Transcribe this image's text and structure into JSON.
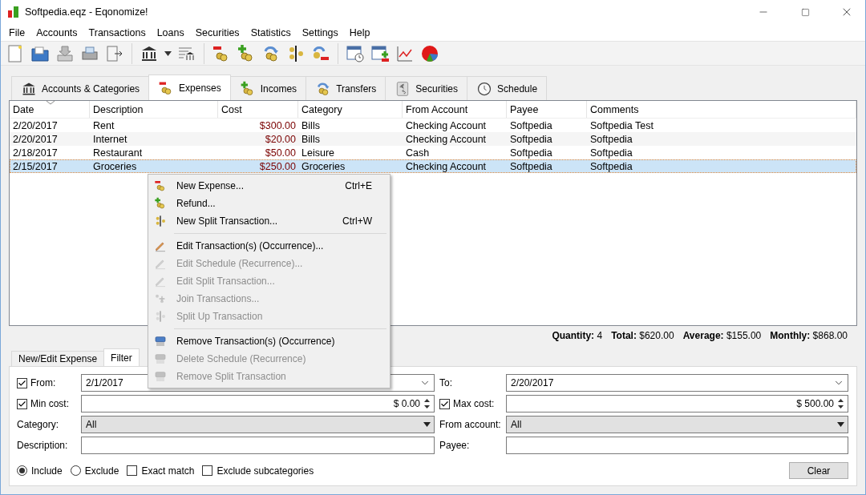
{
  "window": {
    "title": "Softpedia.eqz - Eqonomize!"
  },
  "menu_bar": [
    "File",
    "Accounts",
    "Transactions",
    "Loans",
    "Securities",
    "Statistics",
    "Settings",
    "Help"
  ],
  "tabs": [
    {
      "label": "Accounts & Categories",
      "selected": false
    },
    {
      "label": "Expenses",
      "selected": true
    },
    {
      "label": "Incomes",
      "selected": false
    },
    {
      "label": "Transfers",
      "selected": false
    },
    {
      "label": "Securities",
      "selected": false
    },
    {
      "label": "Schedule",
      "selected": false
    }
  ],
  "table": {
    "columns": [
      {
        "label": "Date",
        "kind": "text"
      },
      {
        "label": "Description",
        "kind": "text"
      },
      {
        "label": "Cost",
        "kind": "money"
      },
      {
        "label": "Category",
        "kind": "text"
      },
      {
        "label": "From Account",
        "kind": "text"
      },
      {
        "label": "Payee",
        "kind": "text"
      },
      {
        "label": "Comments",
        "kind": "text"
      }
    ],
    "rows": [
      {
        "cells": [
          "2/20/2017",
          "Rent",
          "$300.00",
          "Bills",
          "Checking Account",
          "Softpedia",
          "Softpedia Test"
        ],
        "selected": false
      },
      {
        "cells": [
          "2/20/2017",
          "Internet",
          "$20.00",
          "Bills",
          "Checking Account",
          "Softpedia",
          "Softpedia"
        ],
        "selected": false
      },
      {
        "cells": [
          "2/18/2017",
          "Restaurant",
          "$50.00",
          "Leisure",
          "Cash",
          "Softpedia",
          "Softpedia"
        ],
        "selected": false
      },
      {
        "cells": [
          "2/15/2017",
          "Groceries",
          "$250.00",
          "Groceries",
          "Checking Account",
          "Softpedia",
          "Softpedia"
        ],
        "selected": true
      }
    ]
  },
  "summary": [
    "**Quantity:** 4",
    "**Total:** $620.00",
    "**Average:** $155.00",
    "**Monthly:** $868.00"
  ],
  "context_menu": {
    "groups": [
      [
        {
          "label": "New Expense...",
          "shortcut": "Ctrl+E",
          "disabled": false
        },
        {
          "label": "Refund...",
          "disabled": false
        },
        {
          "label": "New Split Transaction...",
          "shortcut": "Ctrl+W",
          "disabled": false
        }
      ],
      [
        {
          "label": "Edit Transaction(s) (Occurrence)...",
          "disabled": false
        },
        {
          "label": "Edit Schedule (Recurrence)...",
          "disabled": true
        },
        {
          "label": "Edit Split Transaction...",
          "disabled": true
        },
        {
          "label": "Join Transactions...",
          "disabled": true
        },
        {
          "label": "Split Up Transaction",
          "disabled": true
        }
      ],
      [
        {
          "label": "Remove Transaction(s) (Occurrence)",
          "disabled": false
        },
        {
          "label": "Delete Schedule (Recurrence)",
          "disabled": true
        },
        {
          "label": "Remove Split Transaction",
          "disabled": true
        }
      ]
    ]
  },
  "bottom_tabs": [
    {
      "label": "New/Edit Expense",
      "selected": false
    },
    {
      "label": "Filter",
      "selected": true
    }
  ],
  "filter": {
    "from": {
      "label": "From:",
      "checked": true,
      "value": "2/1/2017"
    },
    "to": {
      "label": "To:",
      "value": "2/20/2017"
    },
    "min_cost": {
      "label": "Min cost:",
      "checked": true,
      "value": "$ 0.00"
    },
    "max_cost": {
      "label": "Max cost:",
      "checked": true,
      "value": "$ 500.00"
    },
    "category": {
      "label": "Category:",
      "value": "All"
    },
    "from_account": {
      "label": "From account:",
      "value": "All"
    },
    "description": {
      "label": "Description:"
    },
    "payee": {
      "label": "Payee:"
    },
    "options": [
      {
        "kind": "radio",
        "label": "Include",
        "selected": true
      },
      {
        "kind": "radio",
        "label": "Exclude",
        "selected": false
      },
      {
        "kind": "checkbox",
        "label": "Exact match",
        "checked": false
      },
      {
        "kind": "checkbox",
        "label": "Exclude subcategories",
        "checked": false
      }
    ],
    "clear_button": "Clear"
  }
}
